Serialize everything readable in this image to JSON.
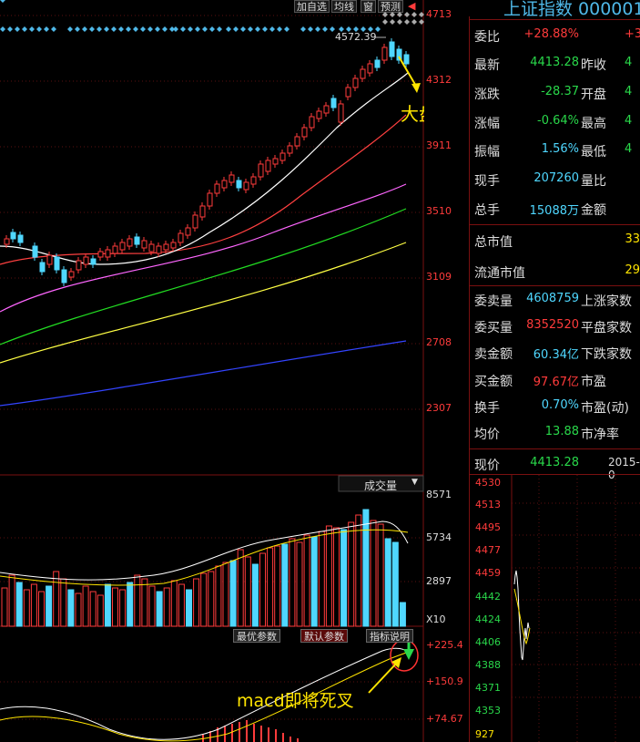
{
  "toolbar": {
    "buttons": [
      "加自选",
      "均线",
      "窗",
      "预测"
    ],
    "arrow": "◀"
  },
  "main_axis": [
    "4713",
    "4312",
    "3911",
    "3510",
    "3109",
    "2708",
    "2307"
  ],
  "peak_label": "4572.39",
  "annotation_top": "大盘短期面临调整",
  "annotation_bottom": "macd即将死叉",
  "volume": {
    "dropdown_label": "成交量",
    "axis": [
      "8571",
      "5734",
      "2897"
    ],
    "unit": "X10"
  },
  "indicator_buttons": [
    "最优参数",
    "默认参数",
    "指标说明"
  ],
  "macd_axis": [
    "+225.4",
    "+150.9",
    "+74.67"
  ],
  "quote": {
    "title": "上证指数 000001",
    "rows": [
      {
        "label": "委比",
        "value": "+28.88%",
        "label2": "",
        "extra": "+3"
      },
      {
        "label": "最新",
        "value": "4413.28",
        "label2": "昨收",
        "extra": "4"
      },
      {
        "label": "涨跌",
        "value": "-28.37",
        "label2": "开盘",
        "extra": "4"
      },
      {
        "label": "涨幅",
        "value": "-0.64%",
        "label2": "最高",
        "extra": "4"
      },
      {
        "label": "振幅",
        "value": "1.56%",
        "label2": "最低",
        "extra": "4"
      },
      {
        "label": "现手",
        "value": "207260",
        "label2": "量比",
        "extra": ""
      },
      {
        "label": "总手",
        "value": "15088万",
        "label2": "金额",
        "extra": ""
      }
    ],
    "market_cap": [
      {
        "label": "总市值",
        "extra": "33"
      },
      {
        "label": "流通市值",
        "extra": "29"
      }
    ],
    "orders": [
      {
        "label": "委卖量",
        "value": "4608759",
        "label2": "上涨家数"
      },
      {
        "label": "委买量",
        "value": "8352520",
        "label2": "平盘家数"
      },
      {
        "label": "卖金额",
        "value": "60.34亿",
        "label2": "下跌家数"
      },
      {
        "label": "买金额",
        "value": "97.67亿",
        "label2": "市盈"
      },
      {
        "label": "换手",
        "value": "0.70%",
        "label2": "市盈(动)"
      },
      {
        "label": "均价",
        "value": "13.88",
        "label2": "市净率"
      }
    ],
    "current": {
      "label": "现价",
      "value": "4413.28",
      "date": "2015-0"
    }
  },
  "mini_axis": [
    "4530",
    "4513",
    "4495",
    "4477",
    "4459",
    "4442",
    "4424",
    "4406",
    "4388",
    "4371",
    "4353",
    "927"
  ],
  "colors": {
    "up": "#ff3b3b",
    "down": "#4fd7ff",
    "ma5": "#ffffff",
    "ma10": "#ffe400",
    "ma20": "#ff4040",
    "ma30": "#ff66ff",
    "ma60": "#22dd22",
    "ma120": "#ffff44",
    "ma250": "#3344ff",
    "frame": "#7a1010"
  }
}
